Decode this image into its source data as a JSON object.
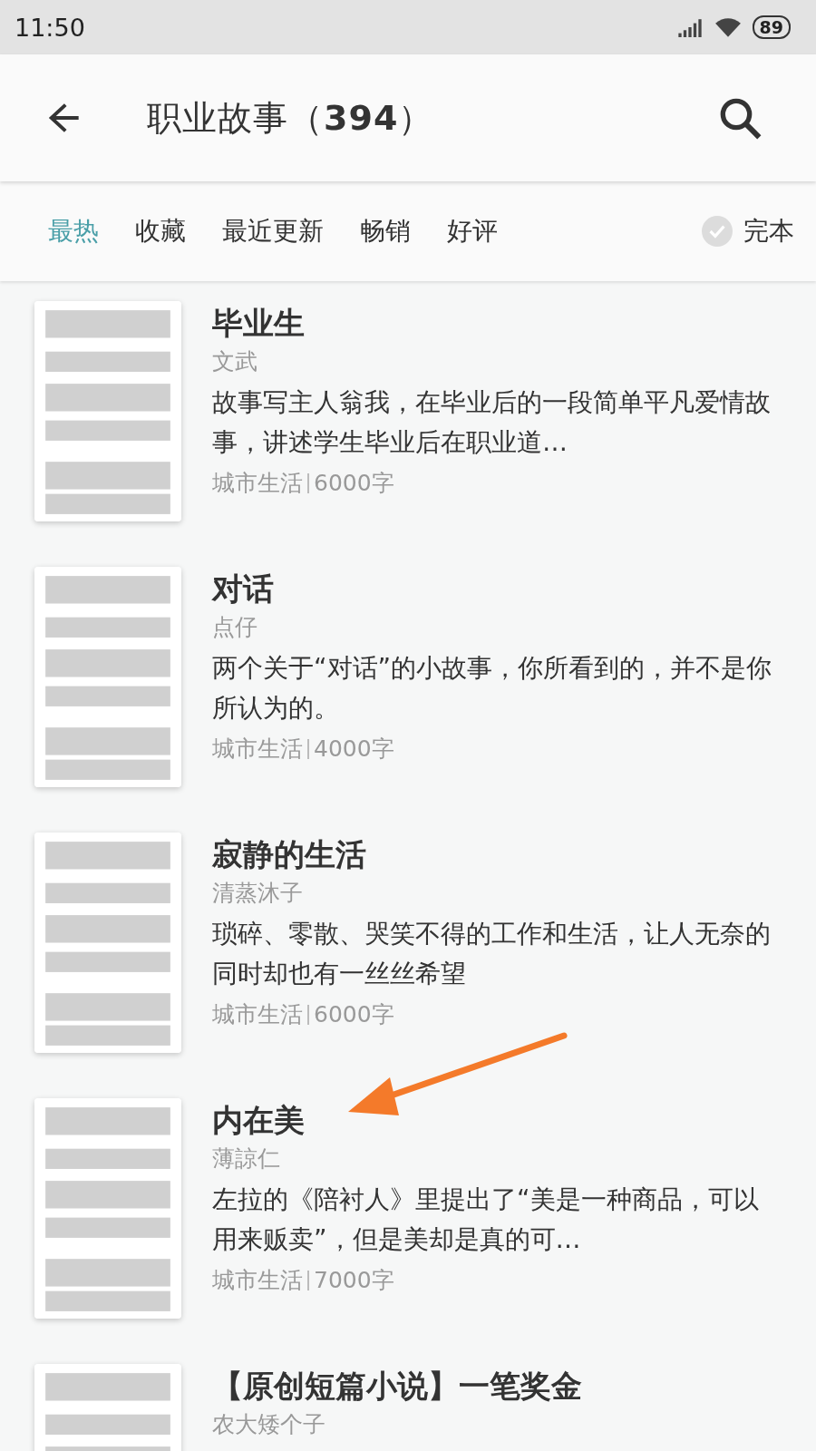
{
  "status_bar": {
    "time": "11:50",
    "battery": "89"
  },
  "app_bar": {
    "title": "职业故事（",
    "count": "394",
    "title_end": "）"
  },
  "filters": [
    {
      "label": "最热",
      "selected": true
    },
    {
      "label": "收藏",
      "selected": false
    },
    {
      "label": "最近更新",
      "selected": false
    },
    {
      "label": "畅销",
      "selected": false
    },
    {
      "label": "好评",
      "selected": false
    }
  ],
  "finished_toggle": {
    "label": "完本",
    "checked": false
  },
  "books": [
    {
      "title": "毕业生",
      "author": "文武",
      "description": "故事写主人翁我，在毕业后的一段简单平凡爱情故事，讲述学生毕业后在职业道…",
      "category": "城市生活",
      "words": "6000字"
    },
    {
      "title": "对话",
      "author": "点仔",
      "description": "两个关于“对话”的小故事，你所看到的，并不是你所认为的。",
      "category": "城市生活",
      "words": "4000字"
    },
    {
      "title": "寂静的生活",
      "author": "清蒸沐子",
      "description": "琐碎、零散、哭笑不得的工作和生活，让人无奈的同时却也有一丝丝希望",
      "category": "城市生活",
      "words": "6000字"
    },
    {
      "title": "内在美",
      "author": "薄諒仁",
      "description": "左拉的《陪衬人》里提出了“美是一种商品，可以用来贩卖”，但是美却是真的可…",
      "category": "城市生活",
      "words": "7000字"
    },
    {
      "title": "【原创短篇小说】一笔奖金",
      "author": "农大矮个子"
    }
  ]
}
